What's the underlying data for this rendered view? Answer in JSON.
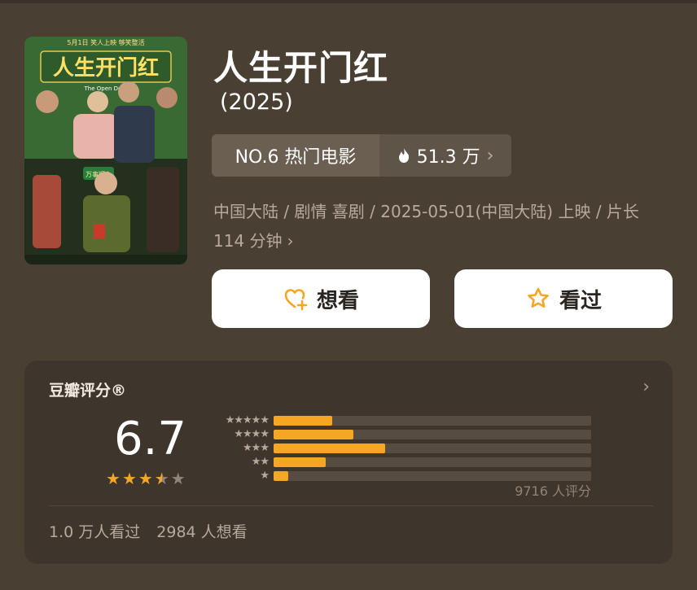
{
  "movie": {
    "title": "人生开门红",
    "year": "(2025)",
    "rank_label": "NO.6 热门电影",
    "heat": "51.3 万",
    "meta": "中国大陆 / 剧情 喜剧 / 2025-05-01(中国大陆) 上映 / 片长114 分钟",
    "poster": {
      "release_line": "5月1日 笑人上映 够笑整活",
      "title_art": "人生开门红",
      "subtitle": "The Open Door",
      "sign": "万事顺心"
    }
  },
  "actions": {
    "want_label": "想看",
    "seen_label": "看过"
  },
  "rating": {
    "section_title": "豆瓣评分®",
    "score": "6.7",
    "stars_value": 3.5,
    "distribution": [
      {
        "stars": 5,
        "label": "★★★★★",
        "percent": 18.5
      },
      {
        "stars": 4,
        "label": "★★★★",
        "percent": 25
      },
      {
        "stars": 3,
        "label": "★★★",
        "percent": 35
      },
      {
        "stars": 2,
        "label": "★★",
        "percent": 16.5
      },
      {
        "stars": 1,
        "label": "★",
        "percent": 4.5
      }
    ],
    "count_text": "9716 人评分"
  },
  "stats": {
    "seen_count": "1.0 万人看过",
    "want_count": "2984 人想看"
  },
  "colors": {
    "background": "#4a3f33",
    "card": "#3e352c",
    "accent": "#f5a623"
  }
}
